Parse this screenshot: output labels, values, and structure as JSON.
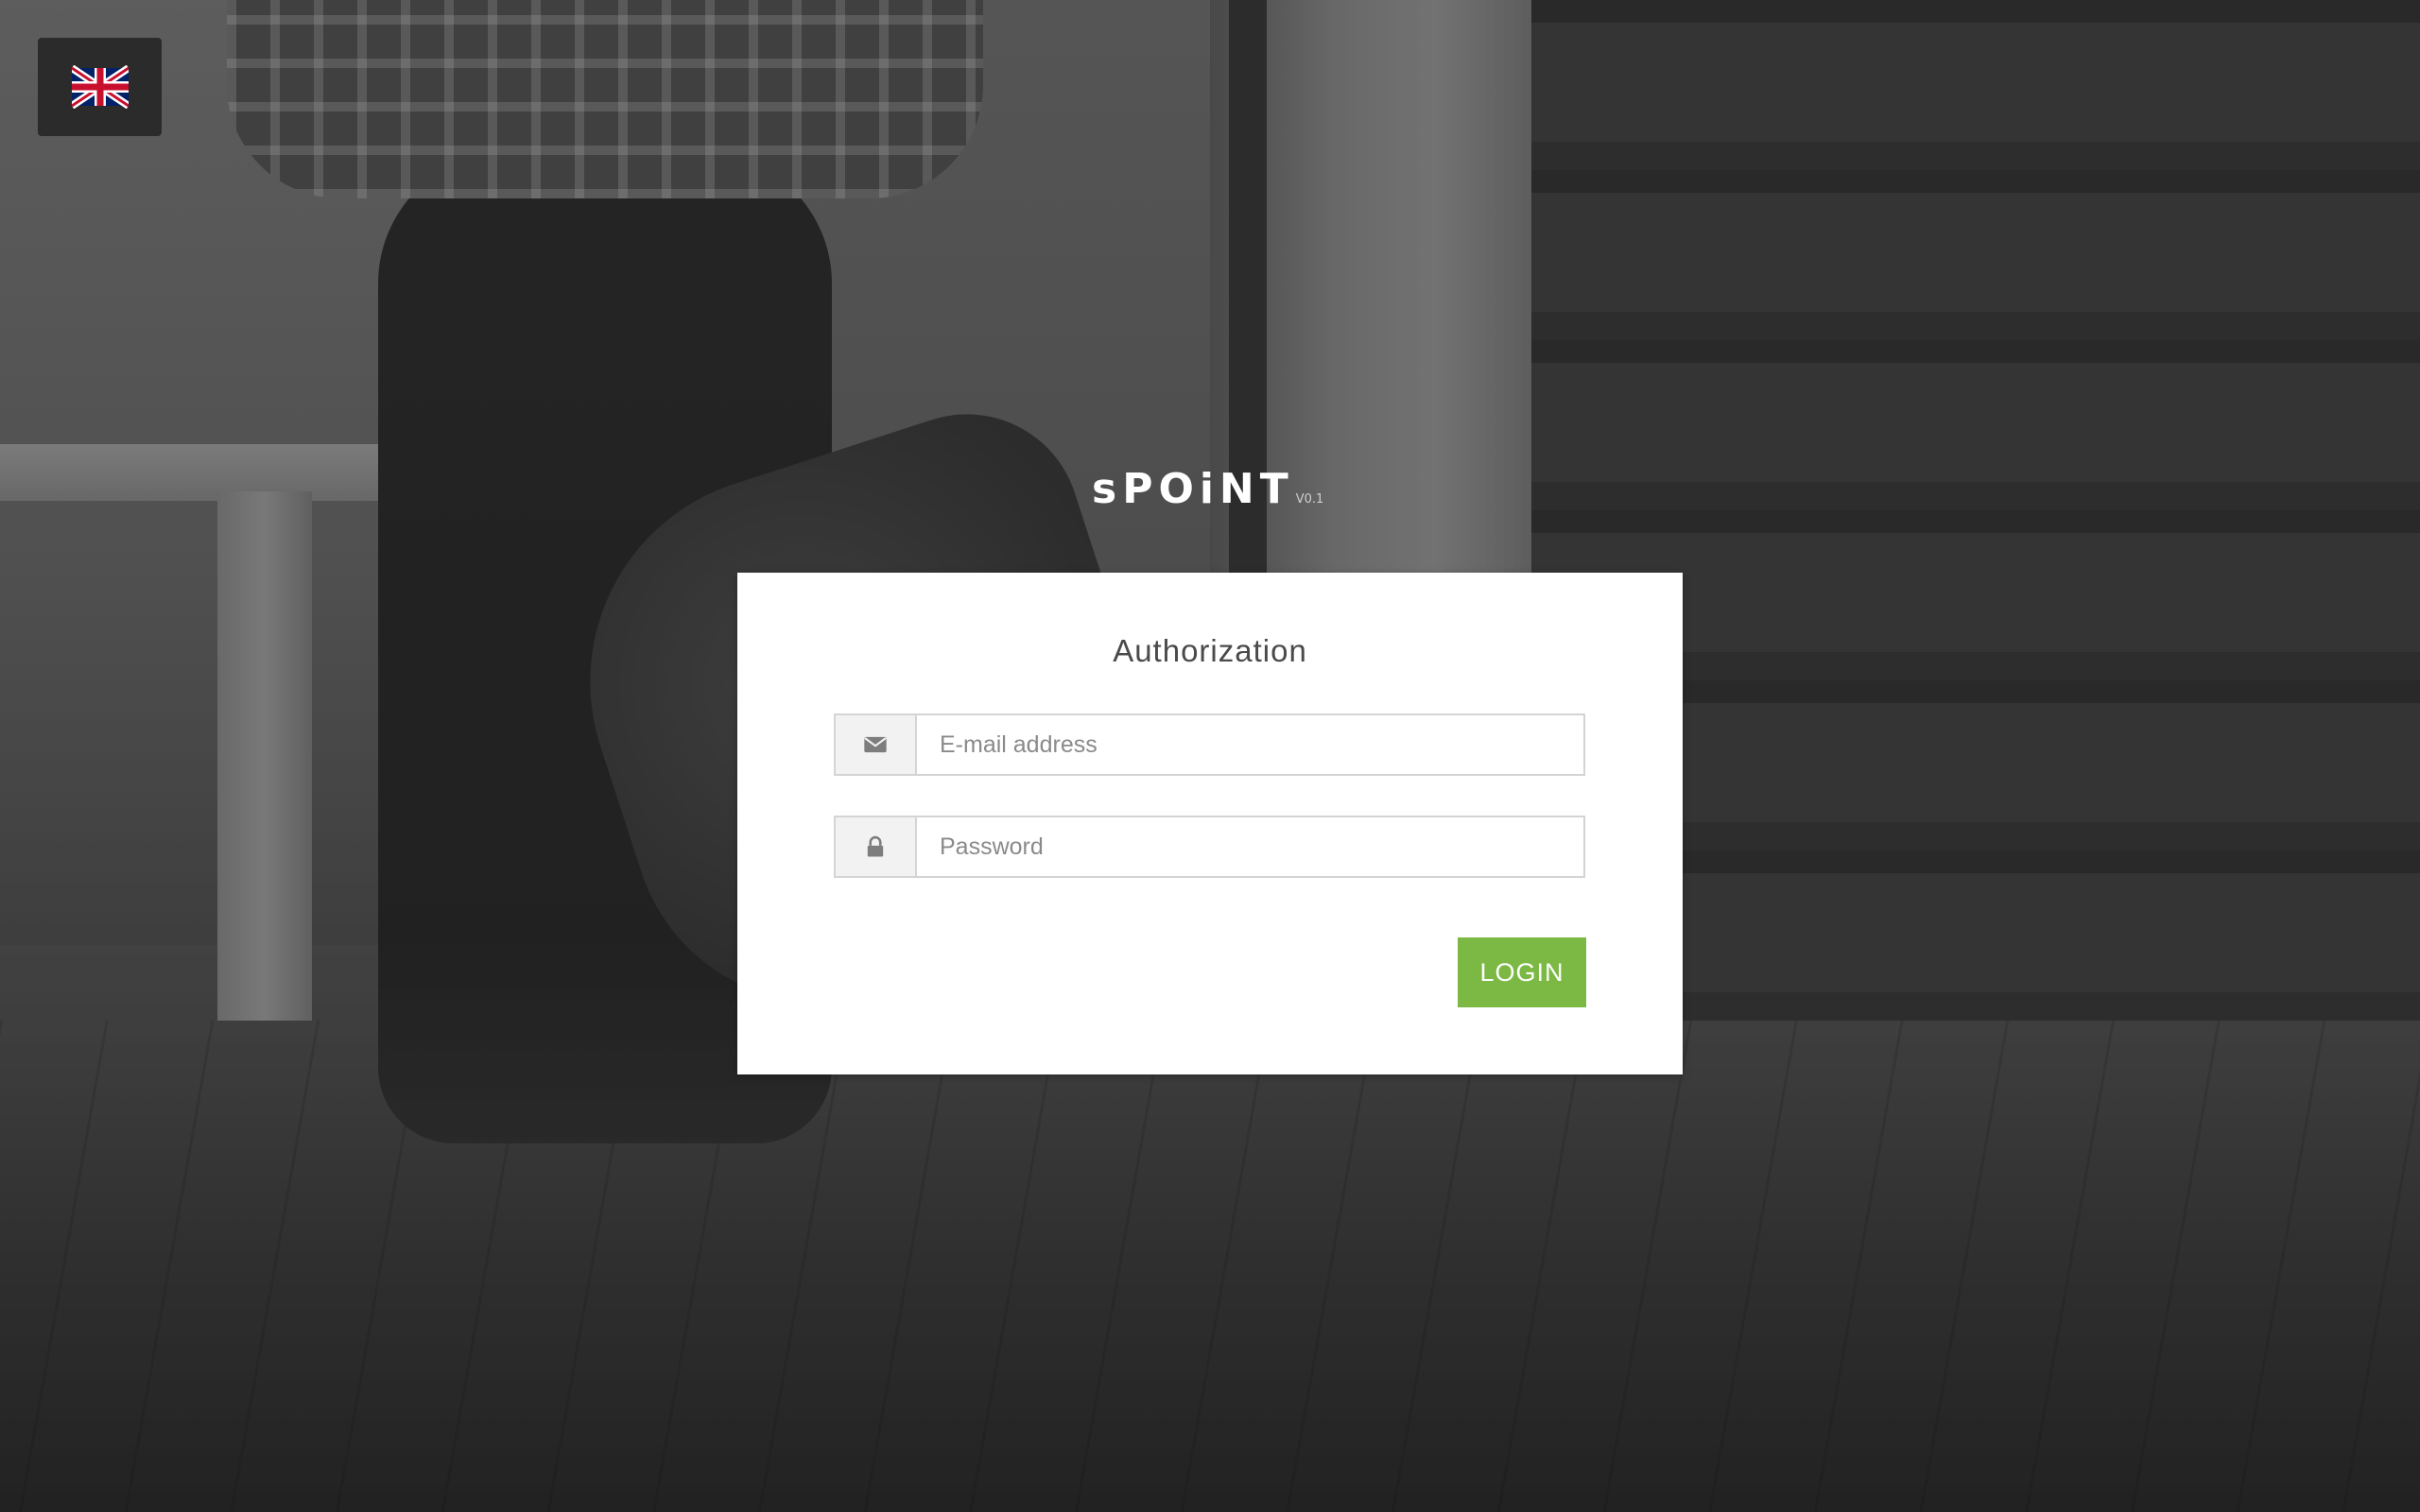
{
  "language": {
    "current": "English",
    "flag_icon": "uk-flag-icon"
  },
  "logo": {
    "text": "sPOiNT",
    "version": "V0.1"
  },
  "auth": {
    "title": "Authorization",
    "email": {
      "value": "",
      "placeholder": "E-mail address",
      "icon": "envelope-icon"
    },
    "password": {
      "value": "",
      "placeholder": "Password",
      "icon": "lock-icon"
    },
    "login_label": "LOGIN"
  },
  "colors": {
    "accent": "#7cb944",
    "card": "#ffffff",
    "lang_bg": "#2b2b2b",
    "addon_bg": "#f2f2f2"
  }
}
